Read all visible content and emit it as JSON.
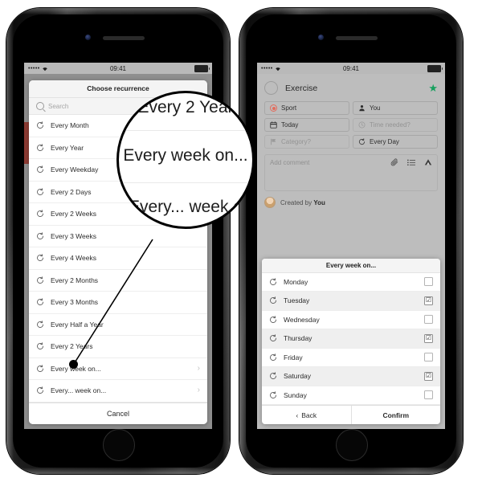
{
  "status_bar": {
    "dots": "•••••",
    "wifi": "wifi-icon",
    "time": "09:41"
  },
  "left_phone": {
    "sheet_title": "Choose recurrence",
    "search_placeholder": "Search",
    "options": [
      {
        "label": "Every Month",
        "chevron": ""
      },
      {
        "label": "Every Year",
        "chevron": ""
      },
      {
        "label": "Every Weekday",
        "chevron": ""
      },
      {
        "label": "Every 2 Days",
        "chevron": ""
      },
      {
        "label": "Every 2 Weeks",
        "chevron": ""
      },
      {
        "label": "Every 3 Weeks",
        "chevron": ""
      },
      {
        "label": "Every 4 Weeks",
        "chevron": ""
      },
      {
        "label": "Every 2 Months",
        "chevron": ""
      },
      {
        "label": "Every 3 Months",
        "chevron": ""
      },
      {
        "label": "Every Half a Year",
        "chevron": ""
      },
      {
        "label": "Every 2 Years",
        "chevron": ""
      },
      {
        "label": "Every week on...",
        "chevron": "›"
      },
      {
        "label": "Every... week on...",
        "chevron": "›"
      }
    ],
    "cancel_label": "Cancel"
  },
  "magnifier": {
    "line1": "Every 2 Year",
    "line2": "Every week on...",
    "line3": "Every... week o"
  },
  "right_phone": {
    "task_title": "Exercise",
    "star_icon": "star-icon",
    "star_color": "#17a05e",
    "chips": [
      {
        "label": "Sport",
        "icon": "category-dot-icon",
        "muted": false
      },
      {
        "label": "You",
        "icon": "person-icon",
        "muted": false
      },
      {
        "label": "Today",
        "icon": "calendar-icon",
        "muted": false
      },
      {
        "label": "Time needed?",
        "icon": "clock-icon",
        "muted": true
      },
      {
        "label": "Category?",
        "icon": "flag-icon",
        "muted": true
      },
      {
        "label": "Every Day",
        "icon": "recurrence-icon",
        "muted": false
      }
    ],
    "accent_color": "#e36b5c",
    "comment_placeholder": "Add comment",
    "comment_icons": [
      "attachment-icon",
      "checklist-icon",
      "drive-icon"
    ],
    "created_prefix": "Created by",
    "created_by": "You",
    "day_sheet": {
      "title": "Every week on...",
      "days": [
        {
          "label": "Monday",
          "checked": false
        },
        {
          "label": "Tuesday",
          "checked": true
        },
        {
          "label": "Wednesday",
          "checked": false
        },
        {
          "label": "Thursday",
          "checked": true
        },
        {
          "label": "Friday",
          "checked": false
        },
        {
          "label": "Saturday",
          "checked": true
        },
        {
          "label": "Sunday",
          "checked": false
        }
      ],
      "back_label": "Back",
      "confirm_label": "Confirm",
      "check_glyph": "☑",
      "back_chevron": "‹"
    }
  }
}
